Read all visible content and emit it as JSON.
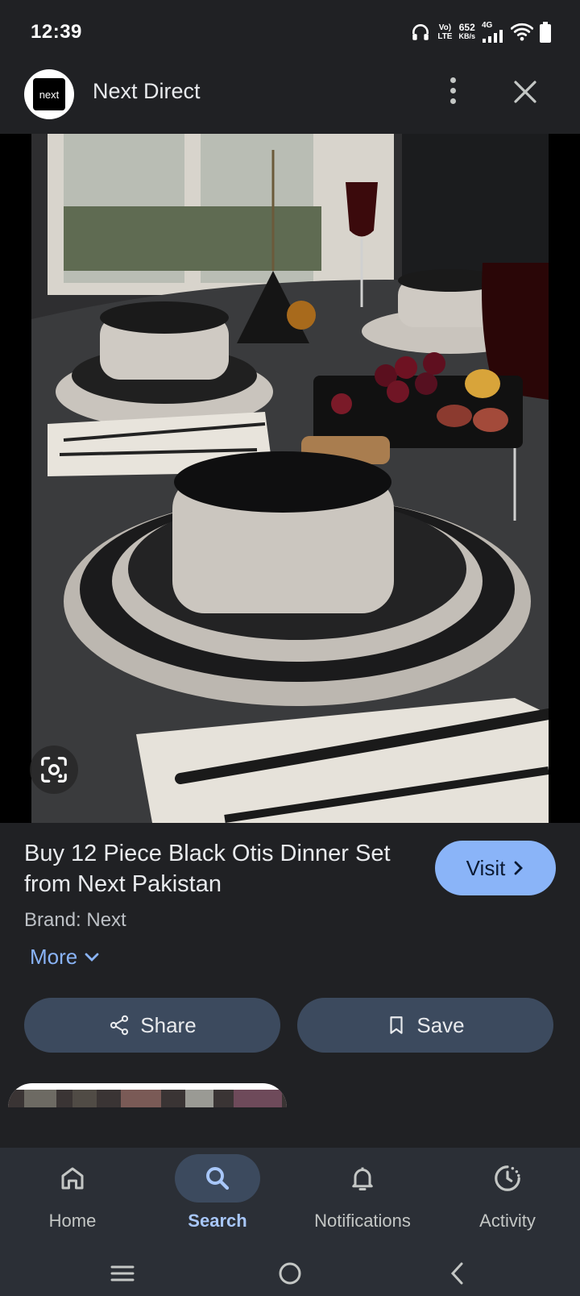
{
  "status_bar": {
    "time": "12:39",
    "volte_top": "Vo)",
    "volte_bottom": "LTE",
    "speed_value": "652",
    "speed_unit": "KB/s",
    "network": "4G"
  },
  "header": {
    "logo_text": "next",
    "site_name": "Next Direct"
  },
  "product": {
    "title": "Buy 12 Piece Black Otis Dinner Set from Next Pakistan",
    "brand": "Brand: Next",
    "more_label": "More",
    "visit_label": "Visit"
  },
  "actions": {
    "share_label": "Share",
    "save_label": "Save"
  },
  "bottom_nav": {
    "items": [
      {
        "label": "Home",
        "icon": "home-icon"
      },
      {
        "label": "Search",
        "icon": "search-icon",
        "active": true
      },
      {
        "label": "Notifications",
        "icon": "bell-icon"
      },
      {
        "label": "Activity",
        "icon": "activity-icon"
      }
    ]
  },
  "colors": {
    "background": "#202124",
    "accent": "#8ab4f8",
    "button_bg": "#3c4a5e",
    "nav_bg": "#2b2f36",
    "active_label": "#a8c7fa"
  }
}
